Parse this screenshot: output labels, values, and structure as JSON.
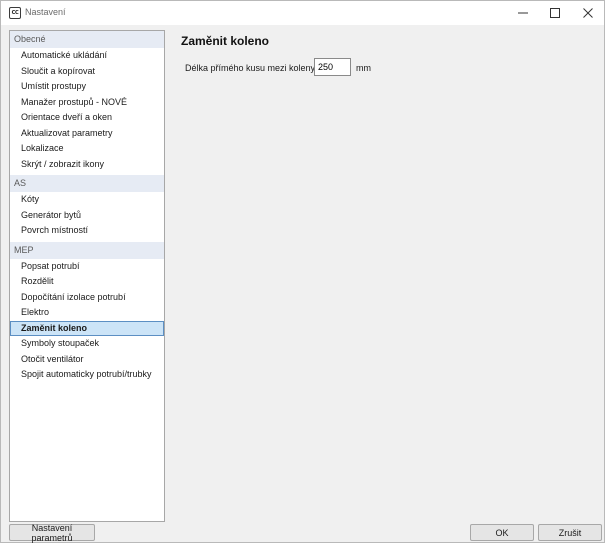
{
  "window": {
    "app_icon_text": "CC",
    "title": "Nastavení",
    "controls": [
      "minimize-icon",
      "maximize-icon",
      "close-icon"
    ]
  },
  "sidebar": {
    "groups": [
      {
        "header": "Obecné",
        "items": [
          "Automatické ukládání",
          "Sloučit a kopírovat",
          "Umístit prostupy",
          "Manažer prostupů - NOVÉ",
          "Orientace dveří a oken",
          "Aktualizovat parametry",
          "Lokalizace",
          "Skrýt / zobrazit ikony"
        ]
      },
      {
        "header": "AS",
        "items": [
          "Kóty",
          "Generátor bytů",
          "Povrch místností"
        ]
      },
      {
        "header": "MEP",
        "items": [
          "Popsat potrubí",
          "Rozdělit",
          "Dopočítání izolace potrubí",
          "Elektro",
          "Zaměnit koleno",
          "Symboly stoupaček",
          "Otočit ventilátor",
          "Spojit automaticky potrubí/trubky"
        ]
      }
    ],
    "selected": "Zaměnit koleno"
  },
  "main": {
    "title": "Zaměnit koleno",
    "field_label": "Délka přímého kusu mezi koleny:",
    "field_value": "250",
    "unit": "mm"
  },
  "footer": {
    "params_button": "Nastavení parametrů",
    "ok_button": "OK",
    "cancel_button": "Zrušit"
  }
}
